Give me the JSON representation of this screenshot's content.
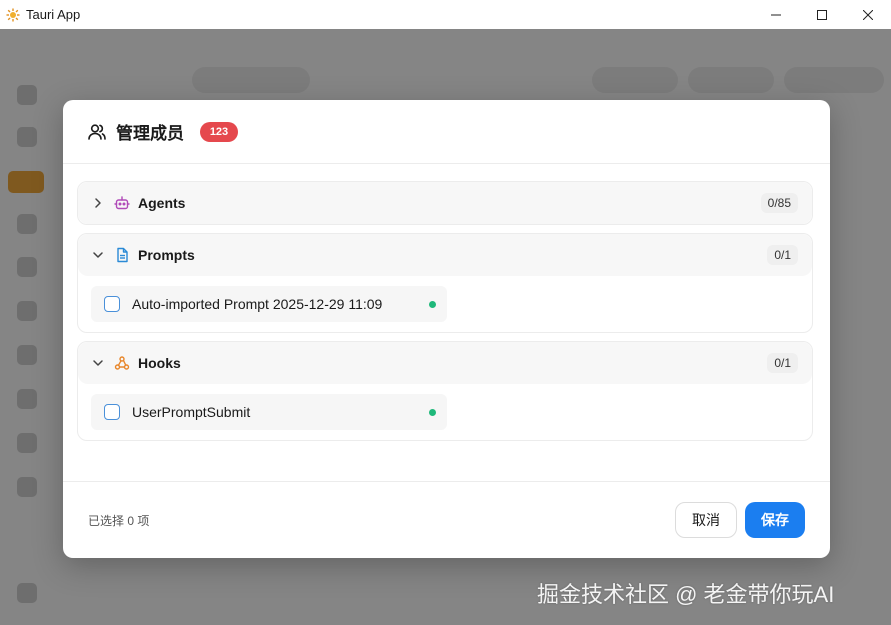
{
  "window": {
    "title": "Tauri App"
  },
  "modal": {
    "title": "管理成员",
    "badge": "123",
    "sections": [
      {
        "name": "Agents",
        "count": "0/85",
        "expanded": false,
        "icon": "robot-icon",
        "color": "#b04ab8",
        "items": []
      },
      {
        "name": "Prompts",
        "count": "0/1",
        "expanded": true,
        "icon": "document-icon",
        "color": "#2a8ad6",
        "items": [
          {
            "label": "Auto-imported Prompt 2025-12-29 11:09",
            "status": "active"
          }
        ]
      },
      {
        "name": "Hooks",
        "count": "0/1",
        "expanded": true,
        "icon": "webhook-icon",
        "color": "#e8862a",
        "items": [
          {
            "label": "UserPromptSubmit",
            "status": "active"
          }
        ]
      }
    ],
    "footer": {
      "selected_text": "已选择 0 项",
      "cancel_label": "取消",
      "save_label": "保存"
    }
  },
  "watermark": "掘金技术社区 @ 老金带你玩AI",
  "colors": {
    "accent": "#1b7ef0",
    "badge": "#e5484d",
    "status_active": "#1fb87a"
  }
}
